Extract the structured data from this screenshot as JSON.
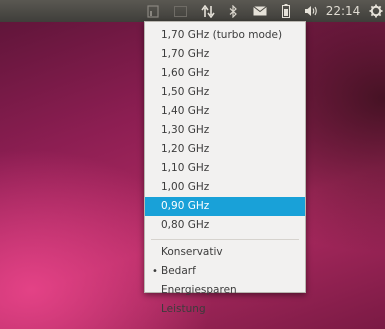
{
  "panel": {
    "clock": "22:14",
    "indicators": [
      "cpufreq-icon",
      "keyboard-icon",
      "network-transfer-icon",
      "bluetooth-icon",
      "mail-icon",
      "battery-icon",
      "volume-icon",
      "settings-gear-icon"
    ]
  },
  "menu": {
    "frequencies": [
      {
        "label": "1,70 GHz (turbo mode)"
      },
      {
        "label": "1,70 GHz"
      },
      {
        "label": "1,60 GHz"
      },
      {
        "label": "1,50 GHz"
      },
      {
        "label": "1,40 GHz"
      },
      {
        "label": "1,30 GHz"
      },
      {
        "label": "1,20 GHz"
      },
      {
        "label": "1,10 GHz"
      },
      {
        "label": "1,00 GHz"
      },
      {
        "label": "0,90 GHz",
        "highlighted": true
      },
      {
        "label": "0,80 GHz"
      }
    ],
    "governors": [
      {
        "label": "Konservativ"
      },
      {
        "label": "Bedarf",
        "active": true,
        "marker": "•"
      },
      {
        "label": "Energiesparen"
      },
      {
        "label": "Leistung"
      }
    ]
  },
  "colors": {
    "panel": "#3f3e3a",
    "menu_bg": "#f2f1f0",
    "highlight": "#19a1d8",
    "wallpaper_accent": "#b12b63"
  }
}
